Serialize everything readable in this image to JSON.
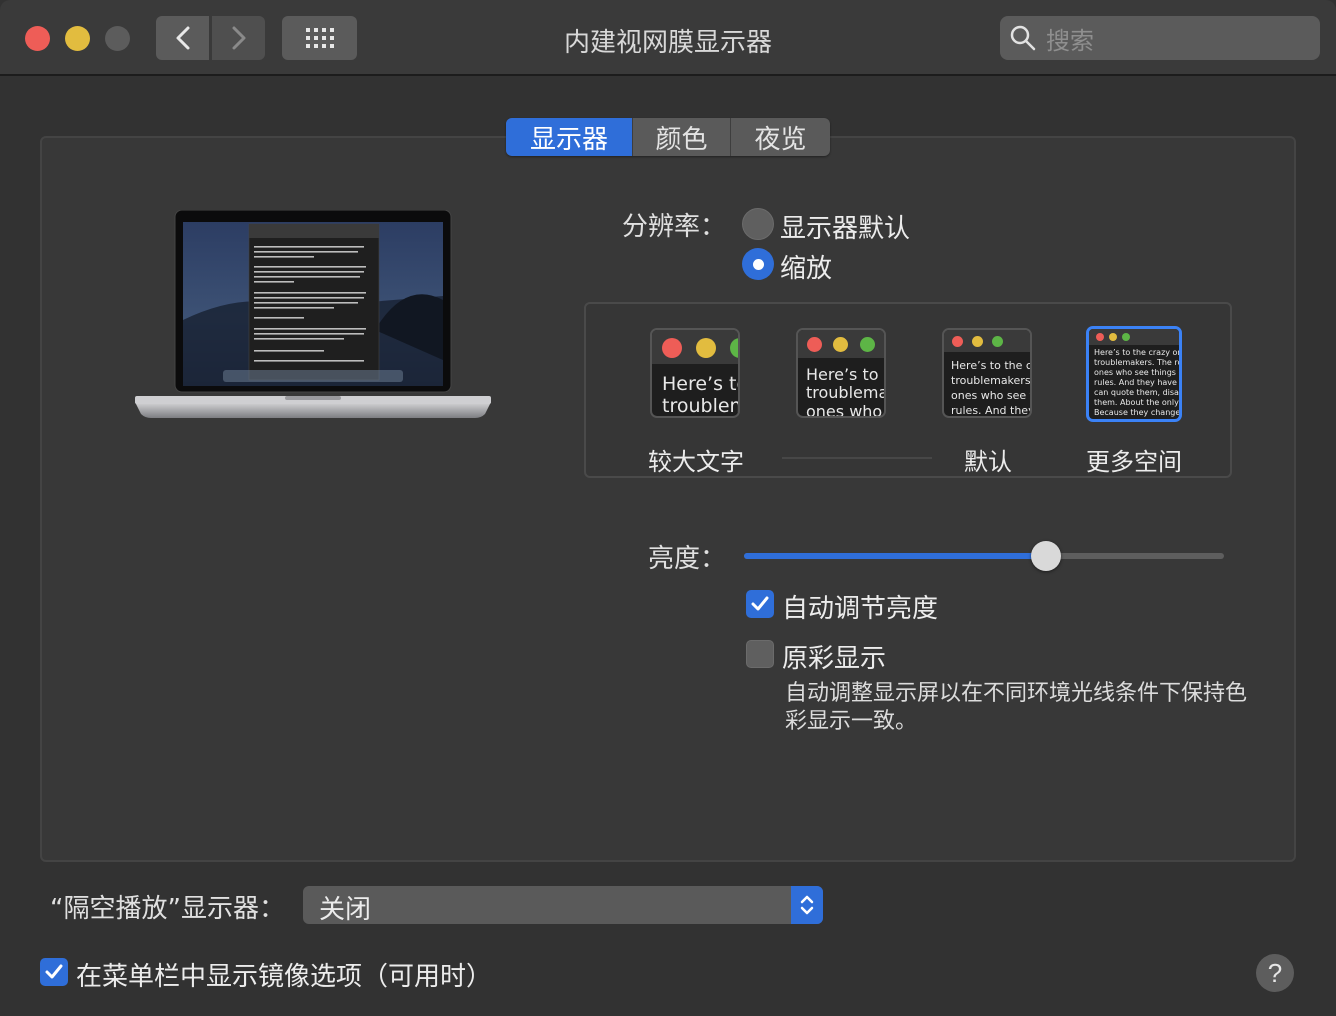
{
  "window": {
    "title": "内建视网膜显示器",
    "search_placeholder": "搜索"
  },
  "tabs": [
    {
      "label": "显示器",
      "active": true
    },
    {
      "label": "颜色",
      "active": false
    },
    {
      "label": "夜览",
      "active": false
    }
  ],
  "resolution": {
    "label": "分辨率：",
    "options": [
      {
        "label": "显示器默认",
        "selected": false
      },
      {
        "label": "缩放",
        "selected": true
      }
    ],
    "scales": [
      {
        "label": "较大文字",
        "preview": "Here’s to the\ntroublemakers"
      },
      {
        "label": "",
        "preview": "Here’s to the\ntroublemakers\nones who"
      },
      {
        "label": "默认",
        "preview": "Here’s to the crazy\ntroublemakers. The\nones who see things\nrules. And they have"
      },
      {
        "label": "更多空间",
        "preview": "Here’s to the crazy ones\ntroublemakers. The round\nones who see things diff\nrules. And they have no\ncan quote them, disagree\nthem. About the only thing\nBecause they change things",
        "selected": true
      }
    ]
  },
  "brightness": {
    "label": "亮度：",
    "level": 0.63,
    "auto_label": "自动调节亮度",
    "auto_checked": true,
    "truetone_label": "原彩显示",
    "truetone_checked": false,
    "truetone_desc": "自动调整显示屏以在不同环境光线条件下保持色彩显示一致。"
  },
  "airplay": {
    "label": "“隔空播放”显示器：",
    "value": "关闭"
  },
  "mirroring": {
    "label": "在菜单栏中显示镜像选项（可用时）",
    "checked": true
  },
  "help_label": "?",
  "colors": {
    "accent": "#2f6ed9",
    "close": "#ee5d57",
    "minimize": "#e2bc3f"
  }
}
